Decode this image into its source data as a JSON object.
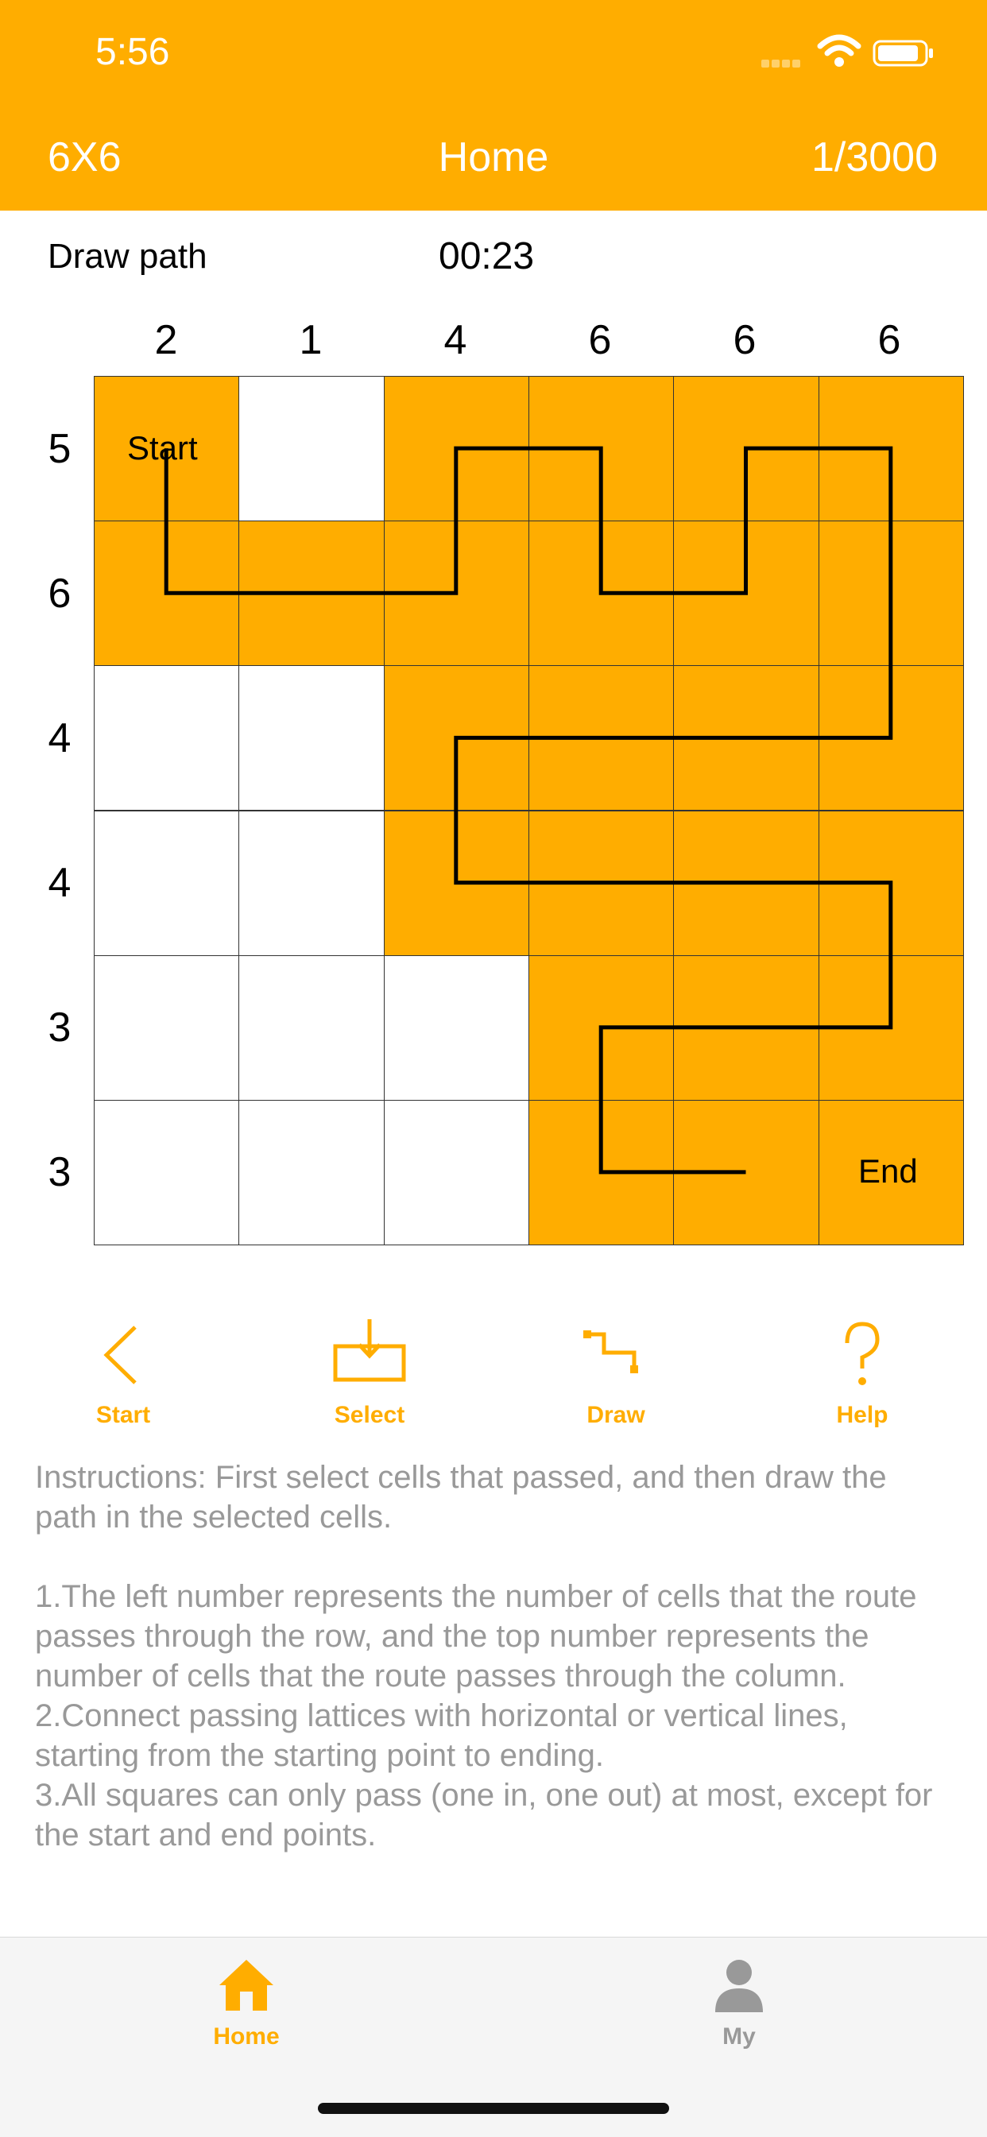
{
  "status_bar": {
    "time": "5:56"
  },
  "nav": {
    "left": "6X6",
    "title": "Home",
    "right": "1/3000"
  },
  "mode_label": "Draw path",
  "timer": "00:23",
  "column_clues": [
    "2",
    "1",
    "4",
    "6",
    "6",
    "6"
  ],
  "row_clues": [
    "5",
    "6",
    "4",
    "4",
    "3",
    "3"
  ],
  "grid": {
    "rows": 6,
    "cols": 6,
    "selected": [
      [
        1,
        0,
        1,
        1,
        1,
        1
      ],
      [
        1,
        1,
        1,
        1,
        1,
        1
      ],
      [
        0,
        0,
        1,
        1,
        1,
        1
      ],
      [
        0,
        0,
        1,
        1,
        1,
        1
      ],
      [
        0,
        0,
        0,
        1,
        1,
        1
      ],
      [
        0,
        0,
        0,
        1,
        1,
        1
      ]
    ],
    "path_cells": [
      [
        0,
        0
      ],
      [
        1,
        0
      ],
      [
        1,
        1
      ],
      [
        1,
        2
      ],
      [
        0,
        2
      ],
      [
        0,
        3
      ],
      [
        1,
        3
      ],
      [
        1,
        4
      ],
      [
        0,
        4
      ],
      [
        0,
        5
      ],
      [
        1,
        5
      ],
      [
        2,
        5
      ],
      [
        2,
        4
      ],
      [
        2,
        3
      ],
      [
        2,
        2
      ],
      [
        3,
        2
      ],
      [
        3,
        3
      ],
      [
        3,
        4
      ],
      [
        3,
        5
      ],
      [
        4,
        5
      ],
      [
        4,
        4
      ],
      [
        4,
        3
      ],
      [
        5,
        3
      ],
      [
        5,
        4
      ]
    ],
    "start_label": "Start",
    "end_label": "End",
    "selected_color": "#FFAD00"
  },
  "toolbar": {
    "start_label": "Start",
    "select_label": "Select",
    "draw_label": "Draw",
    "help_label": "Help",
    "accent_color": "#FFAD00"
  },
  "instructions": "Instructions: First select cells that passed, and then draw the path in the selected cells.\n\n1.The left number represents the number of cells that the route passes through the row, and the top number represents the number of cells that the route passes through the column.\n2.Connect passing lattices with horizontal or vertical lines, starting from the starting point to ending.\n3.All squares can only pass (one in, one out) at most, except for the start and end points.",
  "tabbar": {
    "home_label": "Home",
    "my_label": "My",
    "active_color": "#FFAD00",
    "inactive_color": "#999999"
  }
}
